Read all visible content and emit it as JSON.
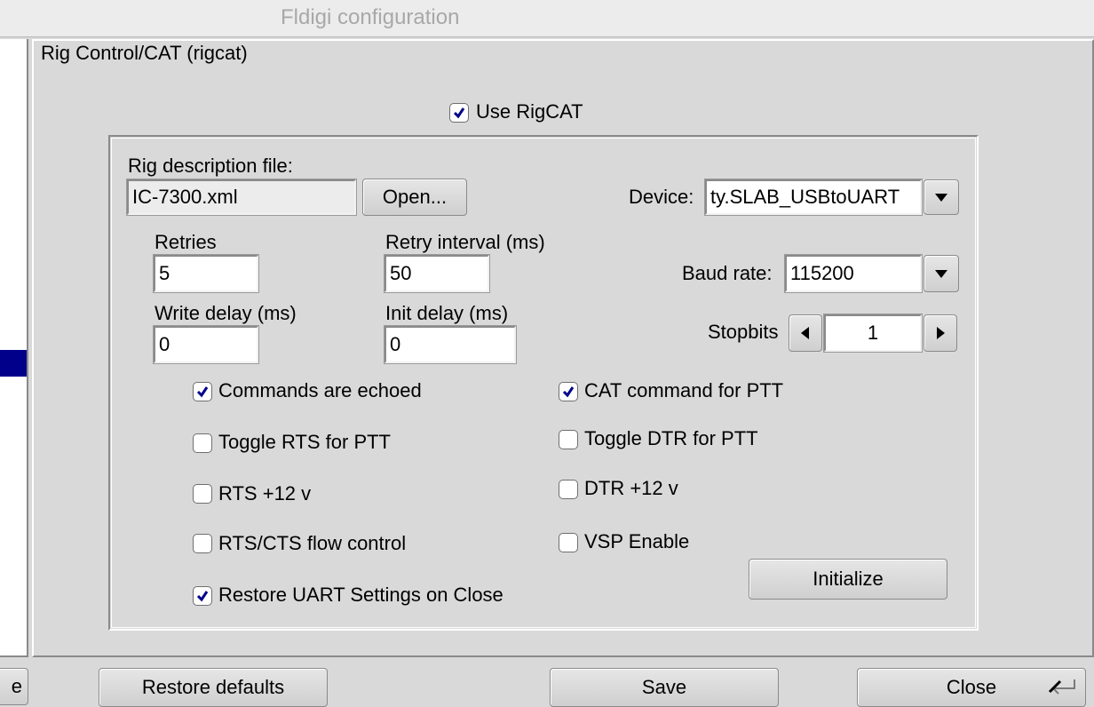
{
  "window": {
    "title": "Fldigi configuration"
  },
  "panel": {
    "title": "Rig Control/CAT (rigcat)"
  },
  "use_rigcat": {
    "label": "Use RigCAT",
    "checked": true
  },
  "rig_description": {
    "label": "Rig description file:",
    "value": "IC-7300.xml",
    "open_label": "Open..."
  },
  "device": {
    "label": "Device:",
    "value": "ty.SLAB_USBtoUART"
  },
  "retries": {
    "label": "Retries",
    "value": "5"
  },
  "retry_interval": {
    "label": "Retry interval (ms)",
    "value": "50"
  },
  "write_delay": {
    "label": "Write delay (ms)",
    "value": "0"
  },
  "init_delay": {
    "label": "Init delay (ms)",
    "value": "0"
  },
  "baud_rate": {
    "label": "Baud rate:",
    "value": "115200"
  },
  "stopbits": {
    "label": "Stopbits",
    "value": "1"
  },
  "options": {
    "commands_echoed": {
      "label": "Commands are echoed",
      "checked": true
    },
    "cat_ptt": {
      "label": "CAT command for PTT",
      "checked": true
    },
    "toggle_rts": {
      "label": "Toggle RTS for PTT",
      "checked": false
    },
    "toggle_dtr": {
      "label": "Toggle DTR for PTT",
      "checked": false
    },
    "rts_12v": {
      "label": "RTS +12 v",
      "checked": false
    },
    "dtr_12v": {
      "label": "DTR +12 v",
      "checked": false
    },
    "rts_cts": {
      "label": "RTS/CTS flow control",
      "checked": false
    },
    "vsp_enable": {
      "label": "VSP Enable",
      "checked": false
    },
    "restore_uart": {
      "label": "Restore UART Settings on Close",
      "checked": true
    }
  },
  "initialize_label": "Initialize",
  "footer": {
    "partial_left": "e",
    "restore_defaults": "Restore defaults",
    "save": "Save",
    "close": "Close"
  },
  "colors": {
    "check": "#00008b",
    "selection": "#00008b",
    "background": "#d9d9d9"
  }
}
